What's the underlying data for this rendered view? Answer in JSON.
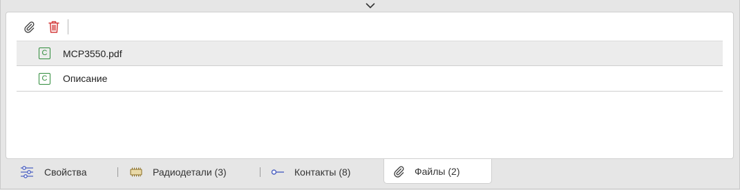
{
  "colors": {
    "accent_blue": "#4a5fc1",
    "delete_red": "#d33b3b",
    "badge_green": "#2e8b3a",
    "chip_gold": "#b08a2e"
  },
  "collapse": {
    "icon": "chevron-down-icon"
  },
  "toolbar": {
    "attach_icon": "paperclip-icon",
    "delete_icon": "trash-icon"
  },
  "files": [
    {
      "badge": "C",
      "name": "MCP3550.pdf",
      "selected": true
    },
    {
      "badge": "C",
      "name": "Описание",
      "selected": false
    }
  ],
  "tabs": [
    {
      "icon": "sliders-icon",
      "label": "Свойства",
      "active": false
    },
    {
      "icon": "chip-icon",
      "label": "Радиодетали (3)",
      "active": false
    },
    {
      "icon": "pin-connector-icon",
      "label": "Контакты (8)",
      "active": false
    },
    {
      "icon": "paperclip-icon",
      "label": "Файлы (2)",
      "active": true
    }
  ]
}
